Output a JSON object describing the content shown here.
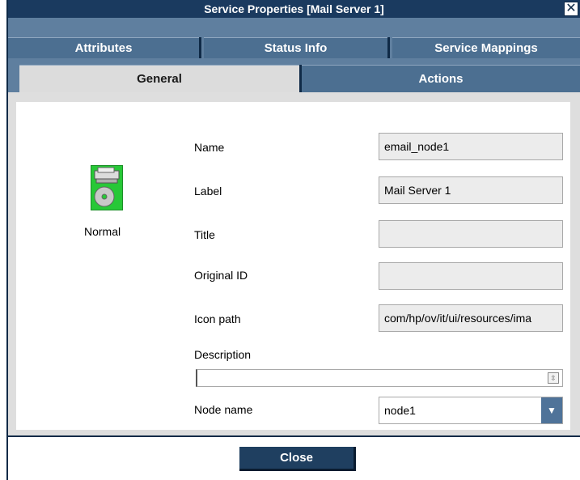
{
  "window": {
    "title": "Service Properties [Mail Server 1]",
    "close_glyph": "✕"
  },
  "tabs": {
    "row1": [
      {
        "label": "Attributes"
      },
      {
        "label": "Status Info"
      },
      {
        "label": "Service Mappings"
      }
    ],
    "row2": [
      {
        "label": "General",
        "active": true
      },
      {
        "label": "Actions",
        "active": false
      }
    ]
  },
  "status": {
    "label": "Normal",
    "icon": "server-status-icon",
    "color": "#27c837"
  },
  "fields": {
    "name": {
      "label": "Name",
      "value": "email_node1"
    },
    "label": {
      "label": "Label",
      "value": "Mail Server 1"
    },
    "title": {
      "label": "Title",
      "value": ""
    },
    "original_id": {
      "label": "Original ID",
      "value": ""
    },
    "icon_path": {
      "label": "Icon path",
      "value": "com/hp/ov/it/ui/resources/ima"
    },
    "description": {
      "label": "Description",
      "value": ""
    },
    "node_name": {
      "label": "Node name",
      "value": "node1"
    }
  },
  "footer": {
    "close_label": "Close"
  }
}
